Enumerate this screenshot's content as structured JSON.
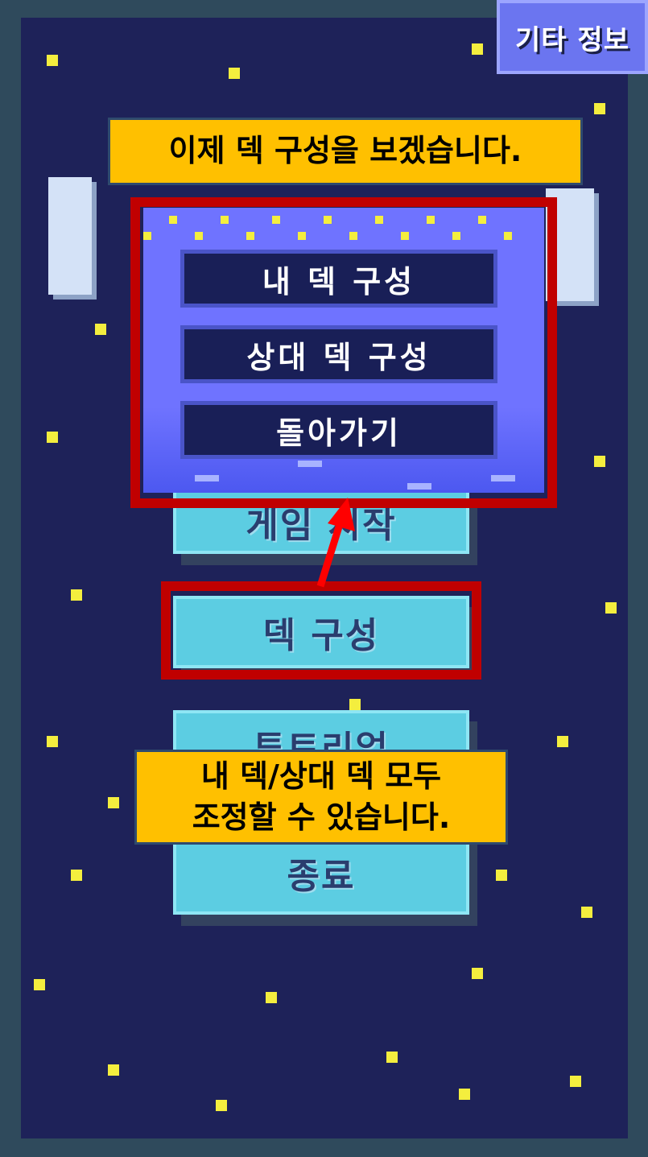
{
  "top_right_button": {
    "label": "기타 정보"
  },
  "menu": {
    "start_label": "게임 시작",
    "deck_label": "덱 구성",
    "tutorial_label": "튜토리얼",
    "quit_label": "종료"
  },
  "popup": {
    "items": [
      {
        "label": "내 덱 구성"
      },
      {
        "label": "상대 덱 구성"
      },
      {
        "label": "돌아가기"
      }
    ]
  },
  "callouts": {
    "top": "이제 덱 구성을 보겠습니다.",
    "bottom_line1": "내 덱/상대 덱 모두",
    "bottom_line2": "조정할 수 있습니다."
  },
  "colors": {
    "background": "#1e2259",
    "star": "#f4ee3e",
    "menu_button": "#5ccde2",
    "popup": "#6f73ff",
    "highlight": "#c00000",
    "callout": "#ffc000",
    "arrow": "#ff0000"
  }
}
